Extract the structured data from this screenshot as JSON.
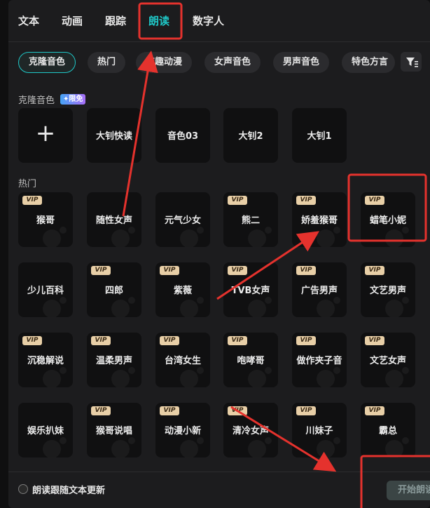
{
  "tabs": [
    {
      "label": "文本"
    },
    {
      "label": "动画"
    },
    {
      "label": "跟踪"
    },
    {
      "label": "朗读"
    },
    {
      "label": "数字人"
    }
  ],
  "filter_chips": [
    {
      "label": "克隆音色"
    },
    {
      "label": "热门"
    },
    {
      "label": "有趣动漫"
    },
    {
      "label": "女声音色"
    },
    {
      "label": "男声音色"
    },
    {
      "label": "特色方言"
    }
  ],
  "clone_section": {
    "label": "克隆音色",
    "badge": "✦限免",
    "add_symbol": "+",
    "voices": [
      "大钊快读",
      "音色03",
      "大钊2",
      "大钊1"
    ]
  },
  "hot_section": {
    "label": "热门",
    "vip_label": "VIP",
    "voices": [
      {
        "name": "猴哥",
        "vip": true
      },
      {
        "name": "随性女声",
        "vip": false
      },
      {
        "name": "元气少女",
        "vip": false
      },
      {
        "name": "熊二",
        "vip": true
      },
      {
        "name": "娇羞猴哥",
        "vip": true
      },
      {
        "name": "蜡笔小妮",
        "vip": true
      },
      {
        "name": "少儿百科",
        "vip": false
      },
      {
        "name": "四郎",
        "vip": true
      },
      {
        "name": "紫薇",
        "vip": true
      },
      {
        "name": "TVB女声",
        "vip": true
      },
      {
        "name": "广告男声",
        "vip": true
      },
      {
        "name": "文艺男声",
        "vip": true
      },
      {
        "name": "沉稳解说",
        "vip": true
      },
      {
        "name": "温柔男声",
        "vip": true
      },
      {
        "name": "台湾女生",
        "vip": true
      },
      {
        "name": "咆哮哥",
        "vip": true
      },
      {
        "name": "做作夹子音",
        "vip": true
      },
      {
        "name": "文艺女声",
        "vip": true
      },
      {
        "name": "娱乐扒妹",
        "vip": false
      },
      {
        "name": "猴哥说唱",
        "vip": true
      },
      {
        "name": "动漫小新",
        "vip": true
      },
      {
        "name": "清冷女声",
        "vip": true
      },
      {
        "name": "川妹子",
        "vip": true
      },
      {
        "name": "霸总",
        "vip": true
      }
    ]
  },
  "footer": {
    "checkbox_label": "朗读跟随文本更新",
    "start_button": "开始朗读"
  },
  "colors": {
    "accent": "#1fc7c7",
    "annotation": "#e5322d",
    "vip_badge": "#e8cfa7"
  }
}
